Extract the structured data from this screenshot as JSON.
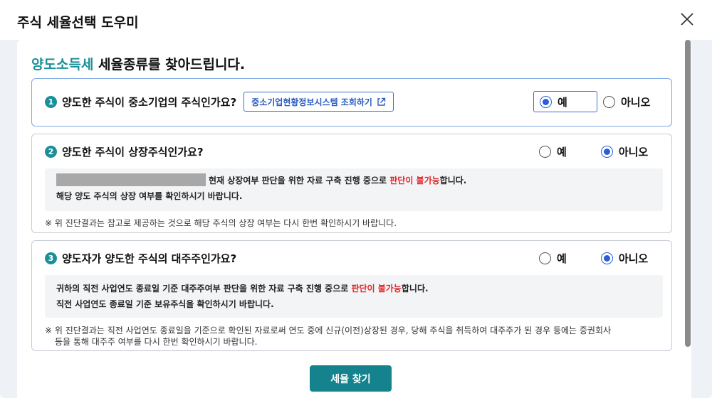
{
  "modal": {
    "title": "주식 세율선택 도우미"
  },
  "heading": {
    "accent": "양도소득세",
    "rest": " 세율종류를 찾아드립니다."
  },
  "questions": [
    {
      "number": "1",
      "text": "양도한 주식이 중소기업의 주식인가요?",
      "link_label": "중소기업현황정보시스템 조회하기",
      "options": [
        "예",
        "아니오"
      ],
      "selected": "예"
    },
    {
      "number": "2",
      "text": "양도한 주식이 상장주식인가요?",
      "options": [
        "예",
        "아니오"
      ],
      "selected": "아니오",
      "info_line1_pre": "현재 상장여부 판단을 위한 자료 구축 진행 중으로 ",
      "info_line1_red": "판단이 불가능",
      "info_line1_post": "합니다.",
      "info_line2": "해당 양도 주식의 상장 여부를 확인하시기 바랍니다.",
      "note": "※ 위 진단결과는 참고로 제공하는 것으로 해당 주식의 상장 여부는 다시 한번 확인하시기 바랍니다."
    },
    {
      "number": "3",
      "text": "양도자가 양도한 주식의 대주주인가요?",
      "options": [
        "예",
        "아니오"
      ],
      "selected": "아니오",
      "info_line1_pre": "귀하의 직전 사업연도 종료일 기준 대주주여부 판단을 위한 자료 구축 진행 중으로 ",
      "info_line1_red": "판단이 불가능",
      "info_line1_post": "합니다.",
      "info_line2": "직전 사업연도 종료일 기준 보유주식을 확인하시기 바랍니다.",
      "note_line1": "※ 위 진단결과는 직전 사업연도 종료일을 기준으로 확인된 자료로써 연도 중에 신규(이전)상장된 경우, 당해 주식을 취득하여 대주주가 된 경우 등에는 증권회사",
      "note_line2": "등을 통해 대주주 여부를 다시 한번 확인하시기 바랍니다."
    }
  ],
  "actions": {
    "find_label": "세율 찾기"
  },
  "colors": {
    "accent": "#1a8f98",
    "button": "#15838d",
    "radio": "#2c5fd0",
    "warning": "#e0262b"
  }
}
